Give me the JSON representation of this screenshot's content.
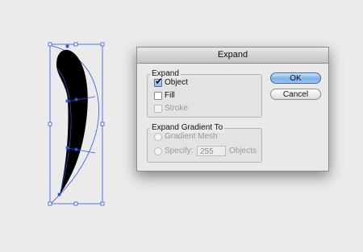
{
  "dialog": {
    "title": "Expand",
    "expand_group": {
      "title": "Expand",
      "object": {
        "label": "Object",
        "checked": true
      },
      "fill": {
        "label": "Fill",
        "checked": false
      },
      "stroke": {
        "label": "Stroke",
        "checked": false,
        "disabled": true
      }
    },
    "gradient_group": {
      "title": "Expand Gradient To",
      "gradient_mesh_label": "Gradient Mesh",
      "specify_label": "Specify:",
      "specify_value": "255",
      "objects_label": "Objects"
    },
    "ok_label": "OK",
    "cancel_label": "Cancel"
  },
  "canvas": {
    "shape_color": "#000000",
    "selection_color": "#3355dd",
    "check_mark": "✔"
  }
}
